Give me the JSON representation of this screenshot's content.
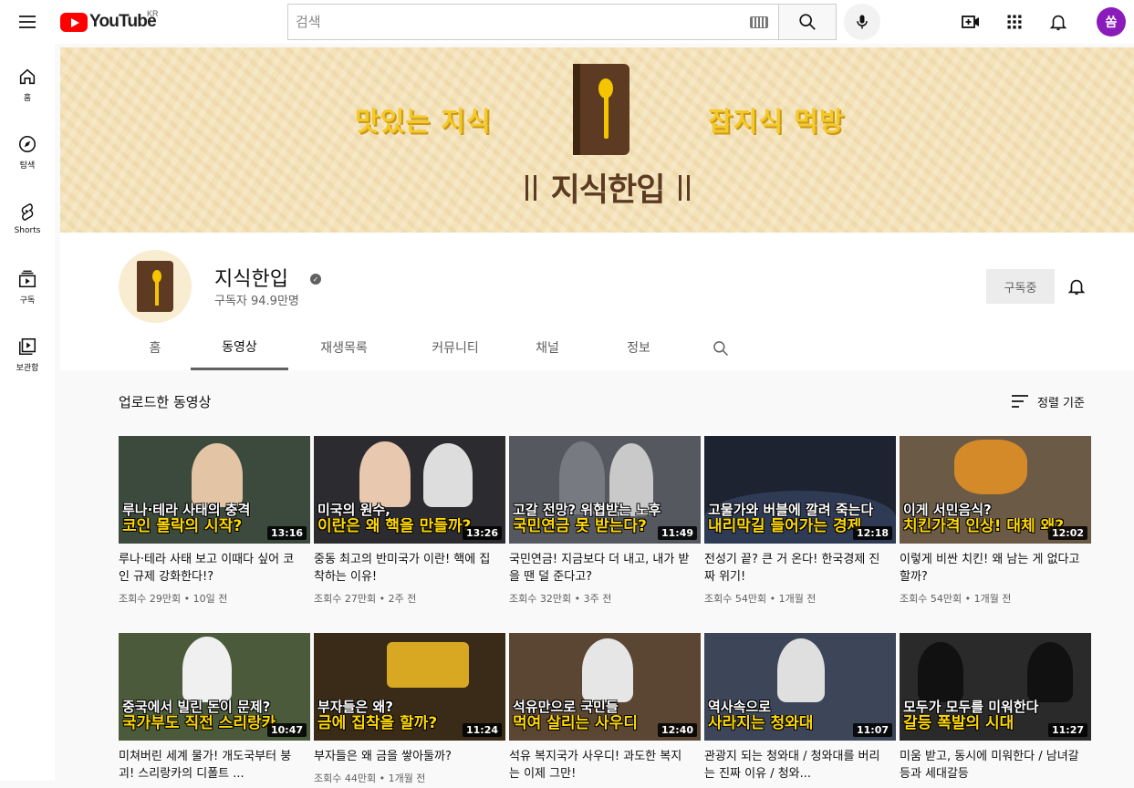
{
  "topbar": {
    "logo_text": "YouTube",
    "region": "KR",
    "search_placeholder": "검색",
    "avatar_letter": "쏨"
  },
  "guide": [
    {
      "label": "홈",
      "icon": "home-icon"
    },
    {
      "label": "탐색",
      "icon": "compass-icon"
    },
    {
      "label": "Shorts",
      "icon": "shorts-icon"
    },
    {
      "label": "구독",
      "icon": "subscriptions-icon"
    },
    {
      "label": "보관함",
      "icon": "library-icon"
    }
  ],
  "banner": {
    "left_text": "맛있는 지식",
    "right_text": "잡지식 먹방",
    "brand_text": "지식한입"
  },
  "channel": {
    "name": "지식한입",
    "subscribers": "구독자 94.9만명",
    "subscribe_label": "구독중"
  },
  "tabs": [
    {
      "label": "홈",
      "active": false
    },
    {
      "label": "동영상",
      "active": true
    },
    {
      "label": "재생목록",
      "active": false
    },
    {
      "label": "커뮤니티",
      "active": false
    },
    {
      "label": "채널",
      "active": false
    },
    {
      "label": "정보",
      "active": false
    }
  ],
  "section": {
    "title": "업로드한 동영상",
    "sort_label": "정렬 기준"
  },
  "videos": [
    {
      "thumb_line1": "루나·테라 사태의 충격",
      "thumb_line2": "코인 몰락의 시작?",
      "duration": "13:16",
      "title": "루나·테라 사태 보고 이때다 싶어 코인 규제 강화한다!?",
      "meta": "조회수 29만회 • 10일 전",
      "bg": "#3b4a3c"
    },
    {
      "thumb_line1": "미국의 원수,",
      "thumb_line2": "이란은 왜 핵을 만들까?",
      "duration": "13:26",
      "title": "중동 최고의 반미국가 이란! 핵에 집착하는 이유!",
      "meta": "조회수 27만회 • 2주 전",
      "bg": "#2b2b30"
    },
    {
      "thumb_line1": "고갈 전망? 위협받는 노후",
      "thumb_line2": "국민연금 못 받는다?",
      "duration": "11:49",
      "title": "국민연금! 지금보다 더 내고, 내가 받을 땐 덜 준다고?",
      "meta": "조회수 32만회 • 3주 전",
      "bg": "#55585e"
    },
    {
      "thumb_line1": "고물가와 버블에 깔려 죽는다",
      "thumb_line2": "내리막길 들어가는 경제",
      "duration": "12:18",
      "title": "전성기 끝? 큰 거 온다! 한국경제 진짜 위기!",
      "meta": "조회수 54만회 • 1개월 전",
      "bg": "#1d2330"
    },
    {
      "thumb_line1": "이게 서민음식?",
      "thumb_line2": "치킨가격 인상! 대체 왜?",
      "duration": "12:02",
      "title": "이렇게 비싼 치킨! 왜 남는 게 없다고 할까?",
      "meta": "조회수 54만회 • 1개월 전",
      "bg": "#6b5a45"
    },
    {
      "thumb_line1": "중국에서 빌린 돈이 문제?",
      "thumb_line2": "국가부도 직전 스리랑카",
      "duration": "10:47",
      "title": "미쳐버린 세계 물가! 개도국부터 붕괴! 스리랑카의 디폴트 ...",
      "meta": "",
      "bg": "#4a5a3a"
    },
    {
      "thumb_line1": "부자들은 왜?",
      "thumb_line2": "금에 집착을 할까?",
      "duration": "11:24",
      "title": "부자들은 왜 금을 쌓아둘까?",
      "meta": "조회수 44만회 • 1개월 전",
      "bg": "#3a2a18"
    },
    {
      "thumb_line1": "석유만으로 국민들",
      "thumb_line2": "먹여 살리는 사우디",
      "duration": "12:40",
      "title": "석유 복지국가 사우디! 과도한 복지는 이제 그만!",
      "meta": "",
      "bg": "#5a4632"
    },
    {
      "thumb_line1": "역사속으로",
      "thumb_line2": "사라지는 청와대",
      "duration": "11:07",
      "title": "관광지 되는 청와대 / 청와대를 버리는 진짜 이유 / 청와...",
      "meta": "",
      "bg": "#3c4658"
    },
    {
      "thumb_line1": "모두가 모두를 미워한다",
      "thumb_line2": "갈등 폭발의 시대",
      "duration": "11:27",
      "title": "미움 받고, 동시에 미워한다 / 남녀갈등과 세대갈등",
      "meta": "",
      "bg": "#2a2a2a"
    }
  ]
}
